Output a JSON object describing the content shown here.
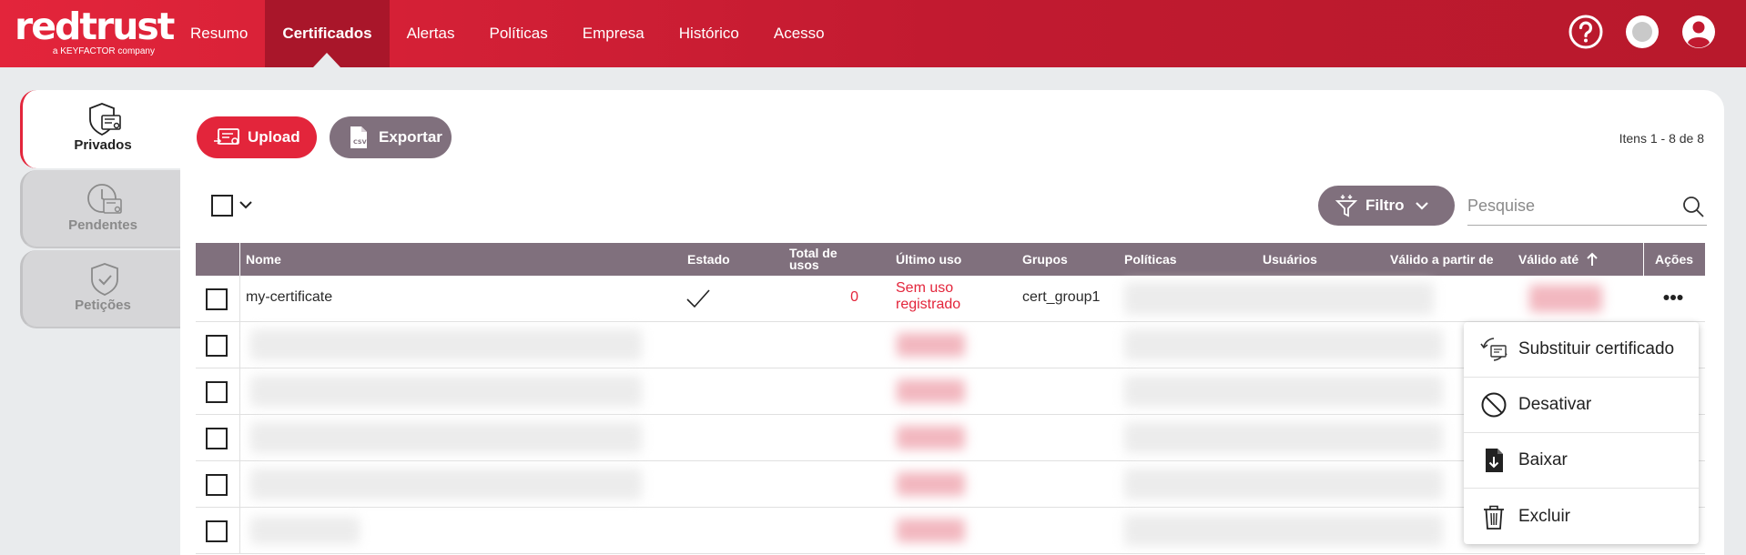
{
  "brand": {
    "logo_text": "redtrust",
    "logo_sub": "a KEYFACTOR company"
  },
  "nav": {
    "items": [
      {
        "label": "Resumo"
      },
      {
        "label": "Certificados"
      },
      {
        "label": "Alertas"
      },
      {
        "label": "Políticas"
      },
      {
        "label": "Empresa"
      },
      {
        "label": "Histórico"
      },
      {
        "label": "Acesso"
      }
    ],
    "active": "Certificados"
  },
  "sidebar": {
    "tabs": [
      {
        "label": "Privados",
        "icon": "shield-certificate-icon",
        "active": true
      },
      {
        "label": "Pendentes",
        "icon": "clock-certificate-icon",
        "active": false
      },
      {
        "label": "Petições",
        "icon": "shield-check-icon",
        "active": false
      }
    ]
  },
  "toolbar": {
    "upload_label": "Upload",
    "export_label": "Exportar",
    "items_count": "Itens 1 - 8 de 8",
    "filter_label": "Filtro",
    "search_placeholder": "Pesquise"
  },
  "table": {
    "columns": [
      {
        "label": "Nome"
      },
      {
        "label": "Estado"
      },
      {
        "label": "Total de usos"
      },
      {
        "label": "Último uso"
      },
      {
        "label": "Grupos"
      },
      {
        "label": "Políticas"
      },
      {
        "label": "Usuários"
      },
      {
        "label": "Válido a partir de"
      },
      {
        "label": "Válido até"
      },
      {
        "label": "Ações"
      }
    ],
    "sorted_column": "Válido até",
    "sort_direction": "ascending",
    "first_row": {
      "name": "my-certificate",
      "state": "check-icon",
      "total_uses": "0",
      "last_use": "Sem uso registrado",
      "groups": "cert_group1"
    },
    "hidden_rows_count": 5
  },
  "actions_menu": {
    "items": [
      {
        "label": "Substituir certificado",
        "icon": "replace-certificate-icon"
      },
      {
        "label": "Desativar",
        "icon": "disable-icon"
      },
      {
        "label": "Baixar",
        "icon": "download-file-icon"
      },
      {
        "label": "Excluir",
        "icon": "trash-icon"
      }
    ]
  },
  "colors": {
    "brand_red": "#e3253b",
    "header_purple": "#80707d",
    "background": "#e9ebed"
  }
}
